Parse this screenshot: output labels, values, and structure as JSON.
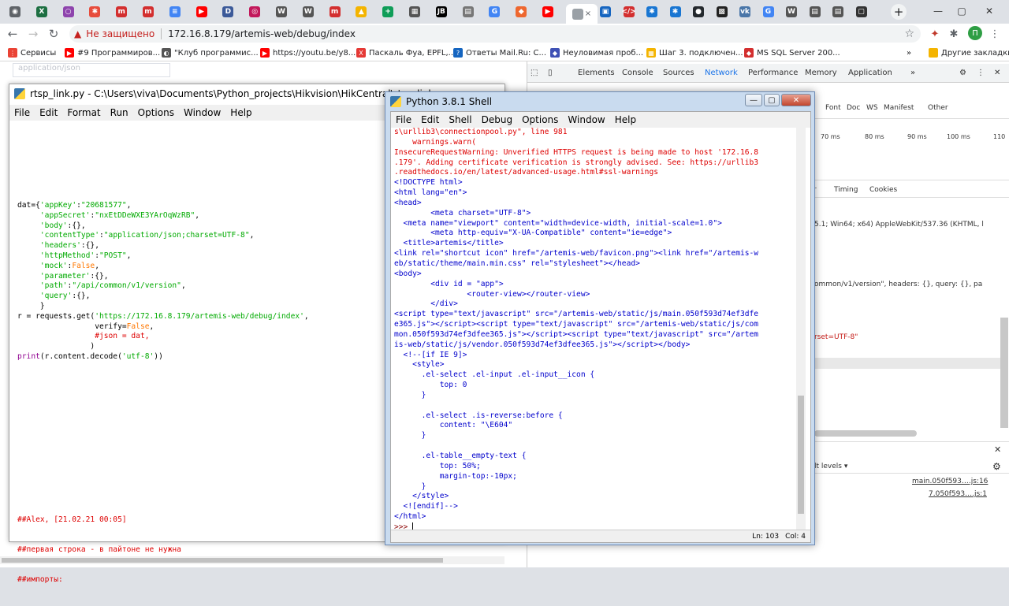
{
  "browser": {
    "tabs_icons": [
      {
        "name": "chrome-icon",
        "color": "#5f6368",
        "glyph": "◉"
      },
      {
        "name": "excel-icon",
        "color": "#1d6f42",
        "glyph": "X"
      },
      {
        "name": "circle-icon",
        "color": "#8e44ad",
        "glyph": "○"
      },
      {
        "name": "puzzle-icon",
        "color": "#e74c3c",
        "glyph": "✱"
      },
      {
        "name": "m-icon",
        "color": "#d32f2f",
        "glyph": "m"
      },
      {
        "name": "m-icon",
        "color": "#d32f2f",
        "glyph": "m"
      },
      {
        "name": "docs-icon",
        "color": "#4285f4",
        "glyph": "≡"
      },
      {
        "name": "youtube-icon",
        "color": "#ff0000",
        "glyph": "▶"
      },
      {
        "name": "d-icon",
        "color": "#3c5a99",
        "glyph": "D"
      },
      {
        "name": "target-icon",
        "color": "#c2185b",
        "glyph": "◎"
      },
      {
        "name": "wikipedia-icon",
        "color": "#555555",
        "glyph": "W"
      },
      {
        "name": "wikipedia-icon",
        "color": "#555555",
        "glyph": "W"
      },
      {
        "name": "m-icon",
        "color": "#d32f2f",
        "glyph": "m"
      },
      {
        "name": "drive-icon",
        "color": "#f4b400",
        "glyph": "▲"
      },
      {
        "name": "plus-doc-icon",
        "color": "#0f9d58",
        "glyph": "+"
      },
      {
        "name": "sheet-icon",
        "color": "#555555",
        "glyph": "▦"
      },
      {
        "name": "jb-icon",
        "color": "#000000",
        "glyph": "JB"
      },
      {
        "name": "doc-icon",
        "color": "#777777",
        "glyph": "▤"
      },
      {
        "name": "google-icon",
        "color": "#4285f4",
        "glyph": "G"
      },
      {
        "name": "magento-icon",
        "color": "#ee672f",
        "glyph": "◆"
      },
      {
        "name": "youtube-icon",
        "color": "#ff0000",
        "glyph": "▶"
      }
    ],
    "active_tab_close": "×",
    "tabs_icons_right": [
      {
        "name": "bookmark-icon",
        "color": "#1565c0",
        "glyph": "▣"
      },
      {
        "name": "code-icon",
        "color": "#d32f2f",
        "glyph": "</>"
      },
      {
        "name": "puzzle-icon",
        "color": "#1976d2",
        "glyph": "✱"
      },
      {
        "name": "puzzle-icon",
        "color": "#1976d2",
        "glyph": "✱"
      },
      {
        "name": "github-icon",
        "color": "#24292e",
        "glyph": "●"
      },
      {
        "name": "qr-icon",
        "color": "#222222",
        "glyph": "▩"
      },
      {
        "name": "vk-icon",
        "color": "#4a76a8",
        "glyph": "vk"
      },
      {
        "name": "google-icon",
        "color": "#4285f4",
        "glyph": "G"
      },
      {
        "name": "wikipedia-icon",
        "color": "#555555",
        "glyph": "W"
      },
      {
        "name": "doc-icon",
        "color": "#555555",
        "glyph": "▤"
      },
      {
        "name": "doc-icon",
        "color": "#555555",
        "glyph": "▤"
      },
      {
        "name": "window-icon",
        "color": "#333333",
        "glyph": "▢"
      }
    ],
    "new_tab": "+",
    "window_controls": [
      "—",
      "▢",
      "✕"
    ],
    "omnibox": {
      "warning_icon": "▲",
      "security_label": "Не защищено",
      "url": "172.16.8.179/artemis-web/debug/index",
      "star_icon": "☆"
    },
    "profile_letter": "П",
    "bookmarks": [
      {
        "label": "Сервисы",
        "color": "#ea4335",
        "glyph": "⋮"
      },
      {
        "label": "#9 Программиров...",
        "color": "#ff0000",
        "glyph": "▶"
      },
      {
        "label": "\"Клуб программис...",
        "color": "#555555",
        "glyph": "◐"
      },
      {
        "label": "https://youtu.be/y8...",
        "color": "#ff0000",
        "glyph": "▶"
      },
      {
        "label": "Паскаль Фуа, EPFL,...",
        "color": "#e53935",
        "glyph": "X"
      },
      {
        "label": "Ответы Mail.Ru: С...",
        "color": "#1565c0",
        "glyph": "?"
      },
      {
        "label": "Неуловимая проб...",
        "color": "#3f51b5",
        "glyph": "◆"
      },
      {
        "label": "Шаг 3. подключен...",
        "color": "#f4b400",
        "glyph": "▦"
      },
      {
        "label": "MS SQL Server 200...",
        "color": "#d32f2f",
        "glyph": "◆"
      }
    ],
    "bookmarks_more": "»",
    "other_bookmarks": "Другие закладки"
  },
  "page": {
    "input_placeholder": "application/json"
  },
  "devtools": {
    "tabs": [
      "Elements",
      "Console",
      "Sources",
      "Network",
      "Performance",
      "Memory",
      "Application",
      "»"
    ],
    "active_tab": "Network",
    "filter_types": [
      "Font",
      "Doc",
      "WS",
      "Manifest",
      "Other"
    ],
    "timeline": [
      "70 ms",
      "80 ms",
      "90 ms",
      "100 ms",
      "110"
    ],
    "detail_tabs": [
      "r",
      "Timing",
      "Cookies"
    ],
    "user_agent": "5.1; Win64; x64) AppleWebKit/537.36 (KHTML, l",
    "request_line": "ommon/v1/version\", headers: {}, query: {}, pa",
    "charset_line": "rset=UTF-8\"",
    "levels": "lt levels ▾",
    "console_links": [
      "main.050f593….js:16",
      "7.050f593….js:1"
    ]
  },
  "editor": {
    "title": "rtsp_link.py - C:\\Users\\viva\\Documents\\Python_projects\\Hikvision\\HikCentral\\rtsp_link.p",
    "menu": [
      "File",
      "Edit",
      "Format",
      "Run",
      "Options",
      "Window",
      "Help"
    ],
    "comments": [
      "##Alex, [21.02.21 00:05]",
      "##первая строка - в пайтоне не нужна",
      "##импорты:"
    ]
  },
  "shell": {
    "title": "Python 3.8.1 Shell",
    "buttons": [
      "—",
      "▢",
      "✕"
    ],
    "menu": [
      "File",
      "Edit",
      "Shell",
      "Debug",
      "Options",
      "Window",
      "Help"
    ],
    "status_ln": "Ln: 103",
    "status_col": "Col: 4",
    "prompt": ">>> "
  }
}
